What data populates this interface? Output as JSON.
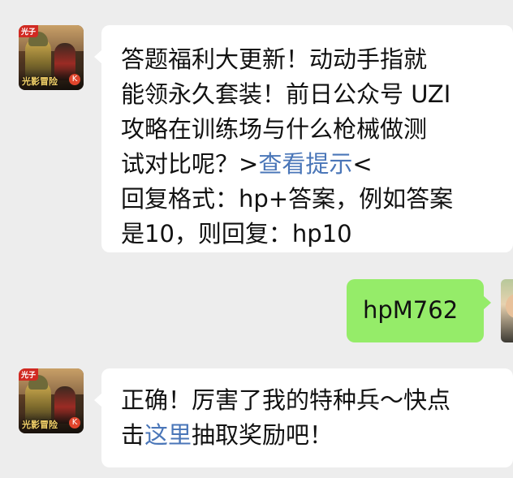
{
  "messages": [
    {
      "sender": "official-account",
      "avatar": {
        "top_label": "光子",
        "logo": "光影冒险",
        "mark": "K"
      },
      "lines": [
        {
          "text": "答题福利大更新！动动手指就"
        },
        {
          "text": "能领永久套装！前日公众号 UZI"
        },
        {
          "text": "攻略在训练场与什么枪械做测"
        },
        {
          "prefix": "试对比呢？>",
          "link": "查看提示",
          "suffix": "<"
        },
        {
          "text": "回复格式：hp+答案，例如答案"
        },
        {
          "text": "是10，则回复：hp10"
        }
      ]
    },
    {
      "sender": "user",
      "text": "hpM762"
    },
    {
      "sender": "official-account",
      "avatar": {
        "top_label": "光子",
        "logo": "光影冒险",
        "mark": "K"
      },
      "lines": [
        {
          "text": "正确！厉害了我的特种兵～快点"
        },
        {
          "prefix": "击",
          "link": "这里",
          "suffix": "抽取奖励吧！"
        }
      ]
    }
  ],
  "colors": {
    "background": "#ededed",
    "incoming_bubble": "#ffffff",
    "outgoing_bubble": "#95ec69",
    "link": "#4a76b8"
  }
}
